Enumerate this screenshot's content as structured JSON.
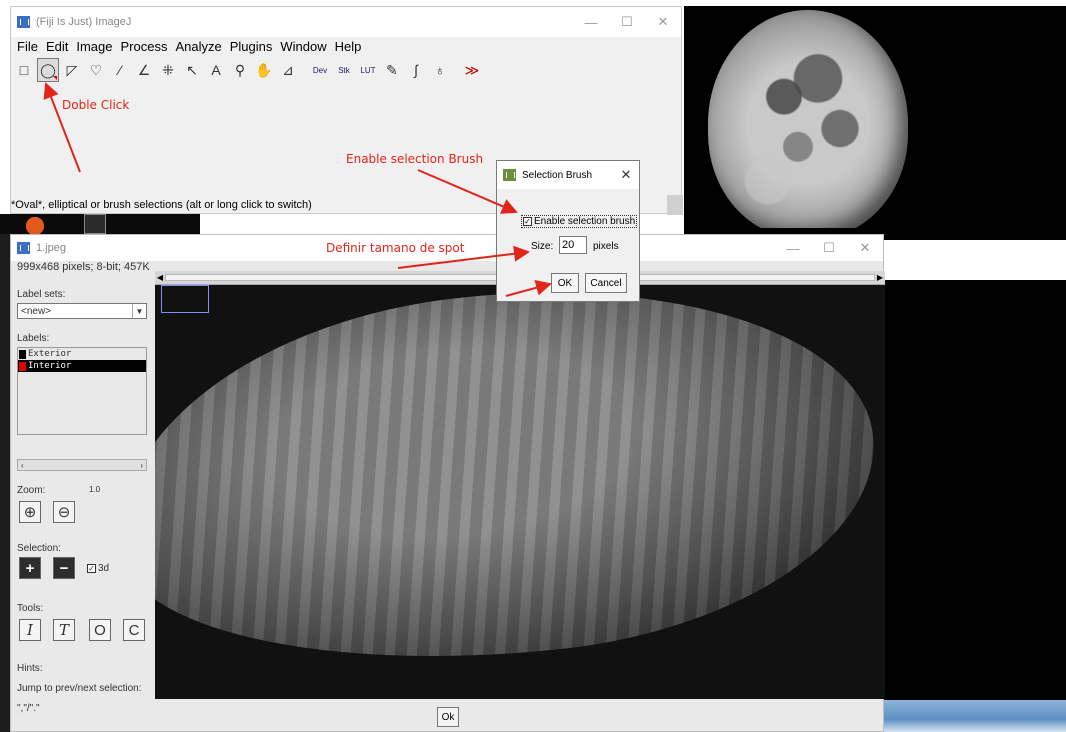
{
  "main_window": {
    "title": "(Fiji Is Just) ImageJ",
    "menus": [
      "File",
      "Edit",
      "Image",
      "Process",
      "Analyze",
      "Plugins",
      "Window",
      "Help"
    ],
    "tools": [
      {
        "name": "rectangle-tool-icon",
        "glyph": "□"
      },
      {
        "name": "oval-tool-icon",
        "glyph": "◯"
      },
      {
        "name": "polygon-tool-icon",
        "glyph": "◸"
      },
      {
        "name": "freehand-tool-icon",
        "glyph": "♡"
      },
      {
        "name": "line-tool-icon",
        "glyph": "⁄"
      },
      {
        "name": "angle-tool-icon",
        "glyph": "∠"
      },
      {
        "name": "point-tool-icon",
        "glyph": "⁜"
      },
      {
        "name": "wand-tool-icon",
        "glyph": "↖"
      },
      {
        "name": "text-tool-icon",
        "glyph": "A"
      },
      {
        "name": "magnifier-tool-icon",
        "glyph": "⚲"
      },
      {
        "name": "hand-tool-icon",
        "glyph": "✋"
      },
      {
        "name": "dropper-tool-icon",
        "glyph": "⊿"
      }
    ],
    "text_tools": [
      "Dev",
      "Stk",
      "LUT"
    ],
    "extra_tools": [
      {
        "name": "pencil-tool-icon",
        "glyph": "✎"
      },
      {
        "name": "brush-tool-icon",
        "glyph": "∫"
      },
      {
        "name": "flood-fill-tool-icon",
        "glyph": "♁"
      }
    ],
    "more_tools_glyph": "≫",
    "status": "*Oval*, elliptical or brush selections (alt or long click to switch)",
    "window_controls": [
      "—",
      "☐",
      "✕"
    ]
  },
  "image_window": {
    "title": "1.jpeg",
    "info": "999x468 pixels; 8-bit; 457K",
    "label_sets_caption": "Label sets:",
    "label_set_value": "<new>",
    "labels_caption": "Labels:",
    "labels": [
      {
        "name": "Exterior",
        "color": "#000000",
        "selected": false
      },
      {
        "name": "Interior",
        "color": "#e00000",
        "selected": true
      }
    ],
    "zoom_caption": "Zoom:",
    "zoom_value": "1.0",
    "selection_caption": "Selection:",
    "chk_3d_label": "3d",
    "tools_caption": "Tools:",
    "tool_buttons": [
      "I",
      "T",
      "O",
      "C"
    ],
    "hints_caption": "Hints:",
    "hint_line1": "Jump to prev/next selection:",
    "hint_line2": "\",\"/\".\"",
    "ok_label": "Ok",
    "window_controls": [
      "—",
      "☐",
      "✕"
    ]
  },
  "dialog": {
    "title": "Selection Brush",
    "checkbox_label": "Enable selection brush",
    "checkbox_checked": true,
    "size_label": "Size:",
    "size_value": "20",
    "size_units": "pixels",
    "ok_label": "OK",
    "cancel_label": "Cancel",
    "close_glyph": "✕"
  },
  "annotations": {
    "doble_click": "Doble Click",
    "enable_brush": "Enable selection Brush",
    "definir": "Definir tamano de spot",
    "color": "#e2241a"
  }
}
